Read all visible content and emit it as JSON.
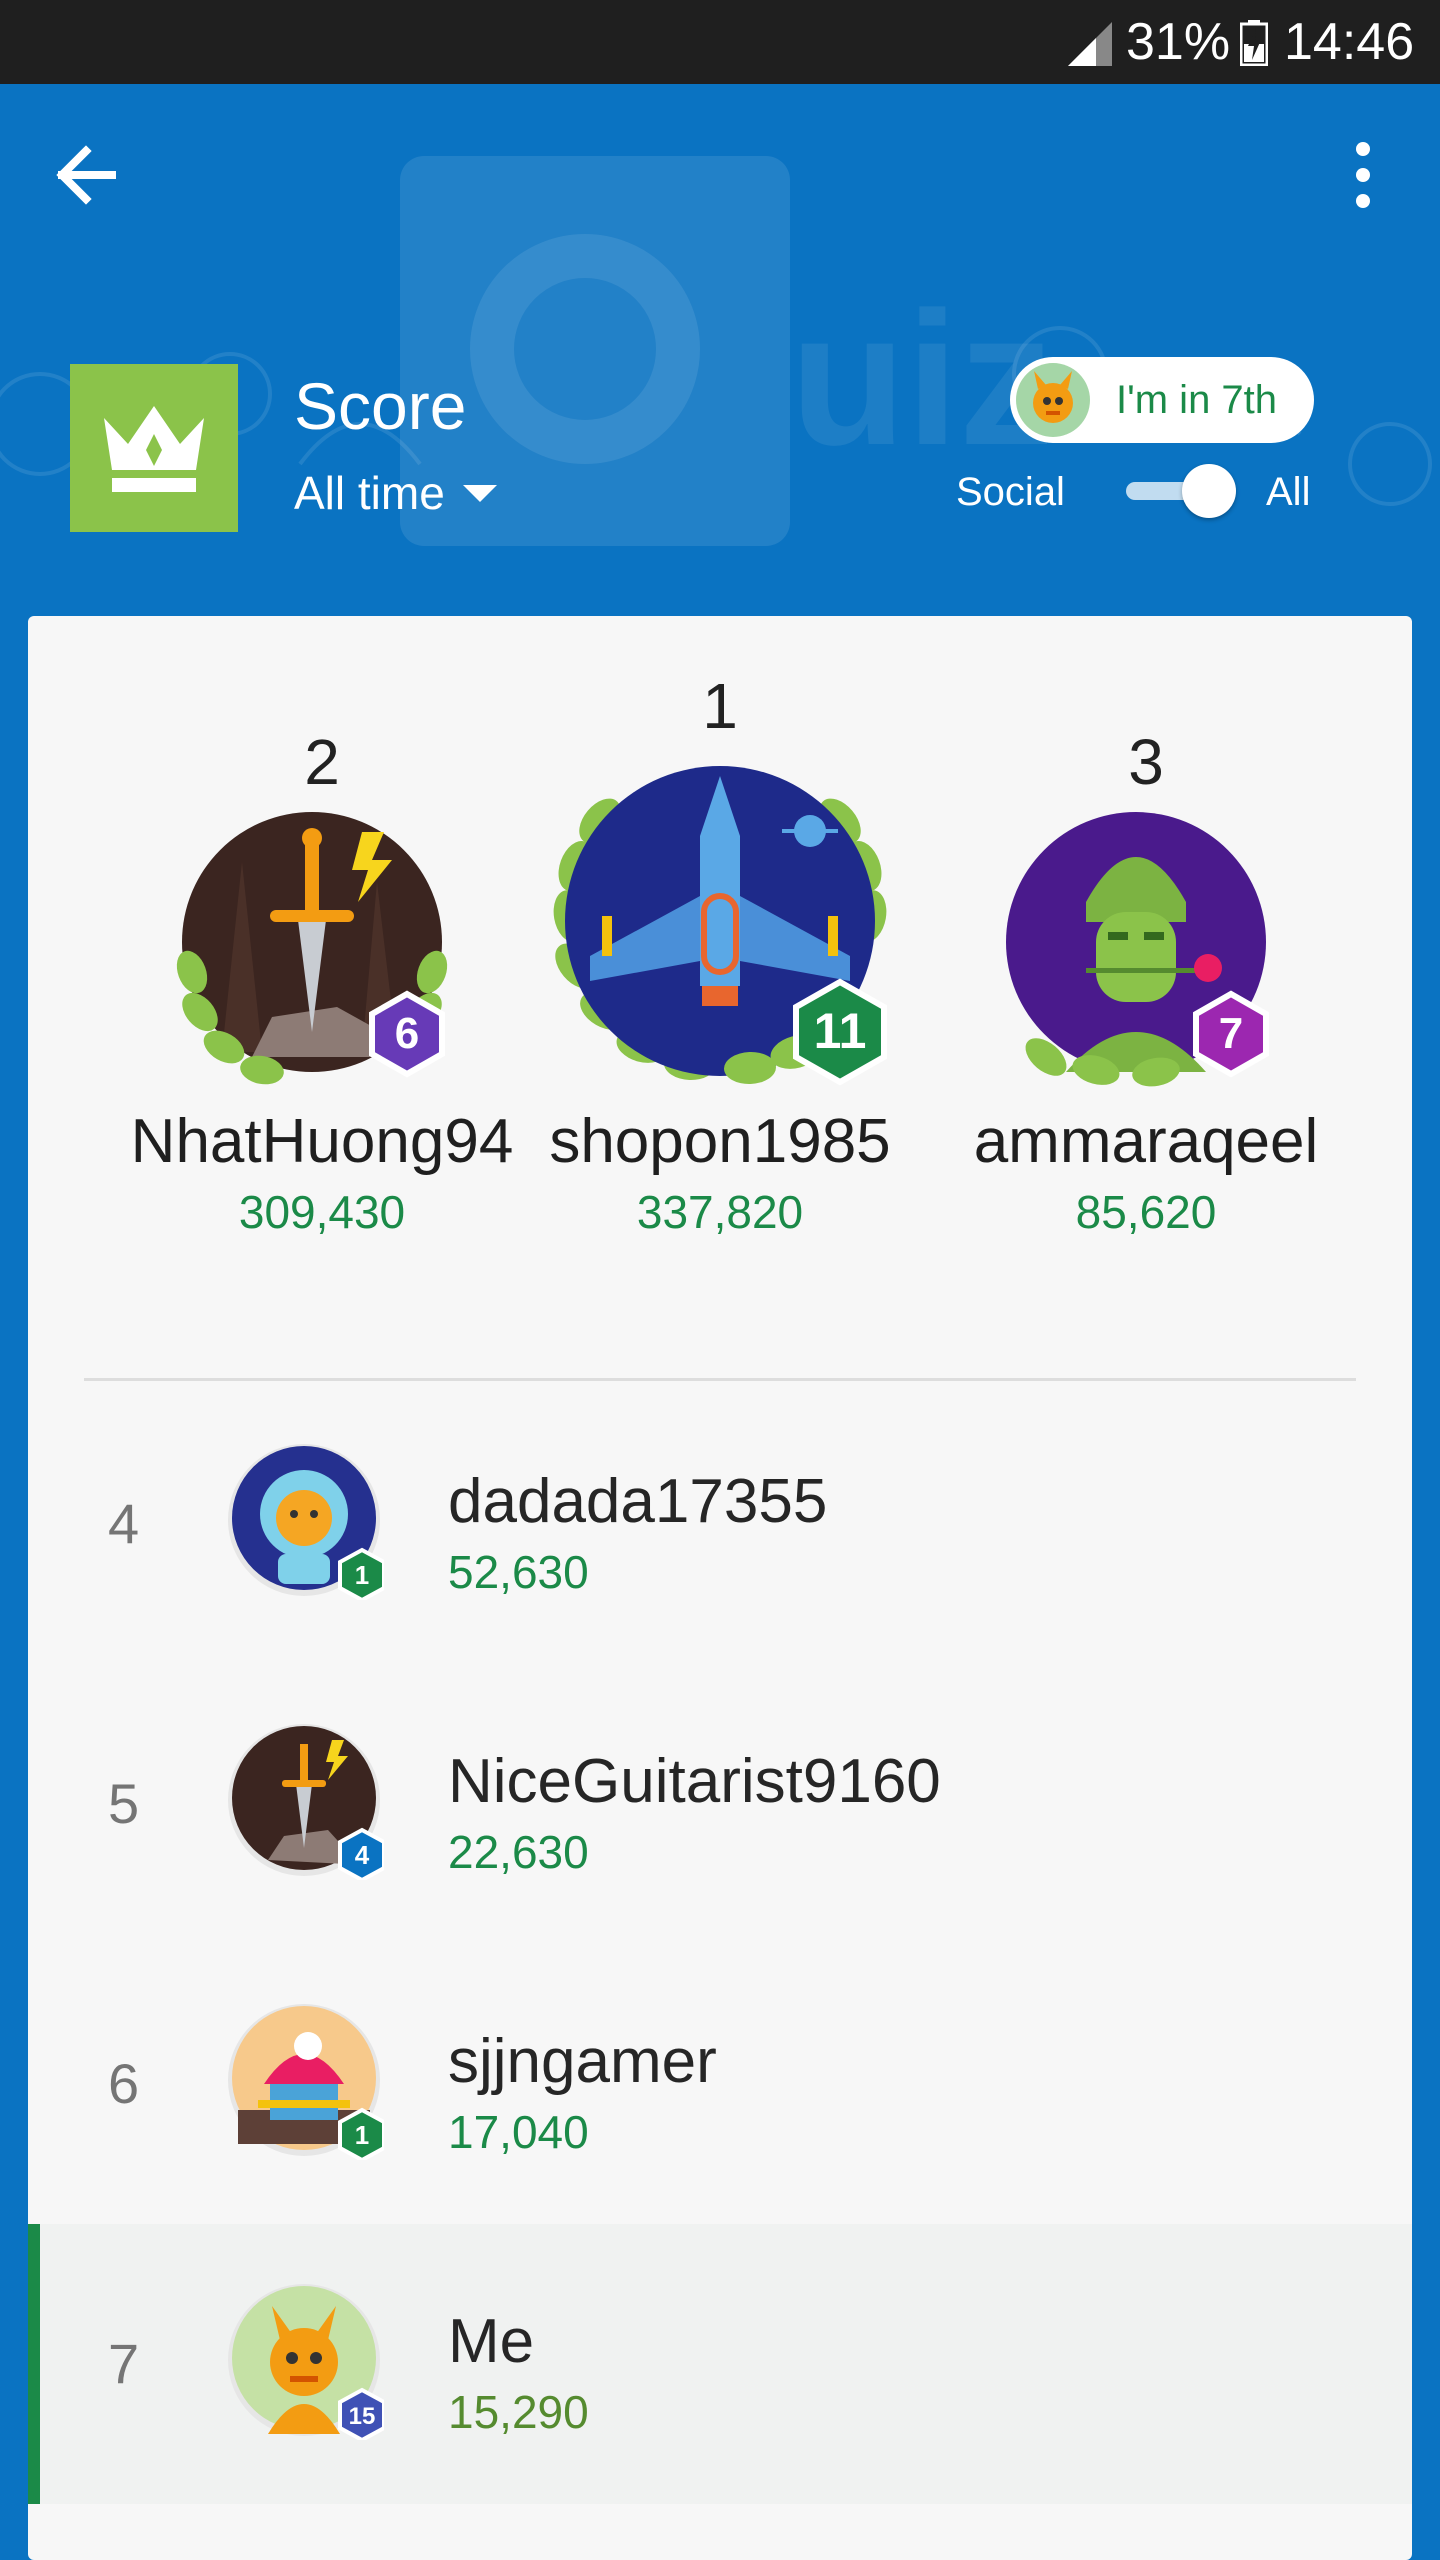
{
  "status_bar": {
    "battery_percent": "31%",
    "time": "14:46"
  },
  "header": {
    "title": "Score",
    "period": "All time",
    "watermark_text": "uiz",
    "rank_pill": "I'm in 7th",
    "toggle": {
      "left_label": "Social",
      "right_label": "All",
      "selected": "All"
    }
  },
  "podium": [
    {
      "rank": "2",
      "name": "NhatHuong94",
      "score": "309,430",
      "level": "6"
    },
    {
      "rank": "1",
      "name": "shopon1985",
      "score": "337,820",
      "level": "11"
    },
    {
      "rank": "3",
      "name": "ammaraqeel",
      "score": "85,620",
      "level": "7"
    }
  ],
  "list": [
    {
      "rank": "4",
      "name": "dadada17355",
      "score": "52,630",
      "level": "1"
    },
    {
      "rank": "5",
      "name": "NiceGuitarist9160",
      "score": "22,630",
      "level": "4"
    },
    {
      "rank": "6",
      "name": "sjjngamer",
      "score": "17,040",
      "level": "1"
    },
    {
      "rank": "7",
      "name": "Me",
      "score": "15,290",
      "level": "15"
    }
  ],
  "colors": {
    "primary": "#0a73c2",
    "accent_green": "#1b8a48",
    "crown_tile": "#8bc34a"
  }
}
